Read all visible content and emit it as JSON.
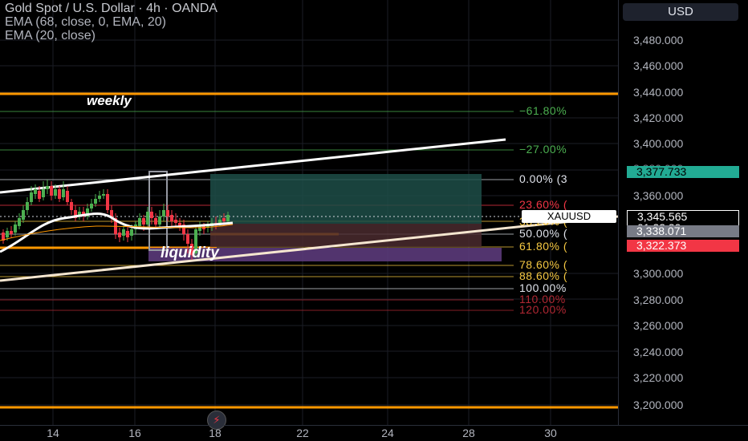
{
  "legend": {
    "title": "Gold Spot / U.S. Dollar · 4h · OANDA",
    "ema68": "EMA (68, close, 0, EMA, 20)",
    "ema20": "EMA (20, close)"
  },
  "currency_button": "USD",
  "y_axis": {
    "ticks": [
      "3,480.000",
      "3,460.000",
      "3,440.000",
      "3,420.000",
      "3,400.000",
      "3,380.000",
      "3,360.000",
      "3,300.000",
      "3,280.000",
      "3,260.000",
      "3,240.000",
      "3,220.000",
      "3,200.000"
    ],
    "partial_label": "3,380.000"
  },
  "price_tags": {
    "top": {
      "value": "3,377.733",
      "bg": "#22ab94"
    },
    "current": {
      "value": "3,345.565",
      "timer": "01:32:39",
      "bg": "#000000"
    },
    "ema": {
      "value": "3,338.071",
      "bg": "#787b86"
    },
    "low": {
      "value": "3,322.373",
      "bg": "#f23645"
    }
  },
  "symbol_tag": "XAUUSD",
  "x_axis": {
    "ticks": [
      "14",
      "16",
      "18",
      "22",
      "24",
      "28",
      "30"
    ]
  },
  "annotations": {
    "weekly": "weekly",
    "liquidity": "liquidity"
  },
  "fib_levels": [
    {
      "label": "−61.80%",
      "color": "#4caf50"
    },
    {
      "label": "−27.00%",
      "color": "#4caf50"
    },
    {
      "label": "0.00% (3",
      "color": "#e0e3eb"
    },
    {
      "label": "23.60% (",
      "color": "#f23645"
    },
    {
      "label": "38.20% (",
      "color": "#f5c842"
    },
    {
      "label": "50.00% (",
      "color": "#e0e3eb"
    },
    {
      "label": "61.80% (",
      "color": "#f5c842"
    },
    {
      "label": "78.60% (",
      "color": "#f5c842"
    },
    {
      "label": "88.60% (",
      "color": "#f5c842"
    },
    {
      "label": "100.00%",
      "color": "#e0e3eb"
    },
    {
      "label": "110.00%",
      "color": "#b22833"
    },
    {
      "label": "120.00%",
      "color": "#b22833"
    }
  ],
  "colors": {
    "orange": "#ff9800",
    "bull": "#4caf50",
    "bear": "#f23645",
    "tp_zone": "#1d4d48",
    "sl_zone": "#4a2a2e",
    "liquidity_zone": "#5b3a7a"
  },
  "icons": {
    "alert": "lightning-icon"
  }
}
